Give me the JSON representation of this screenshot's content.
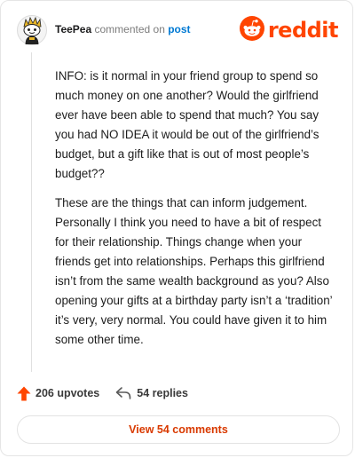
{
  "comment": {
    "username": "TeePea",
    "action_text": "commented on",
    "post_link_label": "post",
    "avatar_icon": "snoo-avatar-icon",
    "paragraphs": [
      "INFO: is it normal in your friend group to spend so much money on one another? Would the girlfriend ever have been able to spend that much? You say you had NO IDEA it would be out of the girlfriend’s budget, but a gift like that is out of most people’s budget??",
      "These are the things that can inform judgement. Personally I think you need to have a bit of respect for their relationship. Things change when your friends get into relationships. Perhaps this girlfriend isn’t from the same wealth background as you? Also opening your gifts at a birthday party isn’t a ‘tradition’ it’s very, very normal. You could have given it to him some other time."
    ],
    "upvotes_label": "206 upvotes",
    "replies_label": "54 replies",
    "view_button_label": "View 54 comments"
  },
  "brand": {
    "wordmark": "reddit",
    "logo_icon": "reddit-snoo-icon",
    "color": "#ff4500"
  },
  "colors": {
    "link": "#0079d3",
    "upvote": "#ff4500",
    "view_button_text": "#d93a00"
  }
}
